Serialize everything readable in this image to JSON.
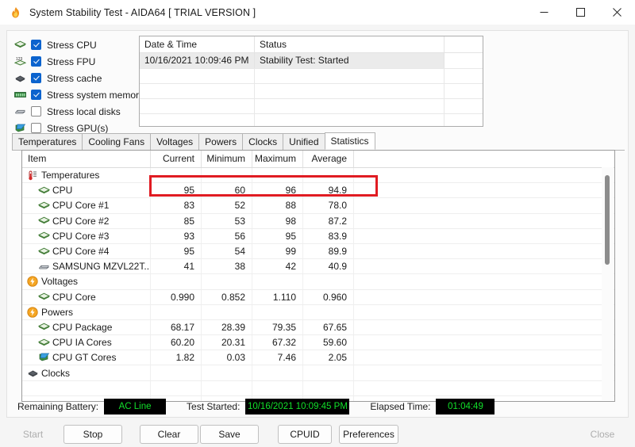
{
  "window": {
    "title": "System Stability Test - AIDA64  [ TRIAL VERSION ]",
    "app_icon": "flame-icon",
    "minimize_label": "minimize-icon",
    "maximize_label": "maximize-icon",
    "close_label": "close-icon"
  },
  "stress": {
    "items": [
      {
        "label": "Stress CPU",
        "checked": true,
        "icon": "cpu-chip-icon"
      },
      {
        "label": "Stress FPU",
        "checked": true,
        "icon": "fpu-chip-icon"
      },
      {
        "label": "Stress cache",
        "checked": true,
        "icon": "cache-icon"
      },
      {
        "label": "Stress system memory",
        "checked": true,
        "icon": "memory-module-icon"
      },
      {
        "label": "Stress local disks",
        "checked": false,
        "icon": "hard-disk-icon"
      },
      {
        "label": "Stress GPU(s)",
        "checked": false,
        "icon": "gpu-card-icon"
      }
    ]
  },
  "log": {
    "headers": [
      "Date & Time",
      "Status",
      ""
    ],
    "rows": [
      {
        "datetime": "10/16/2021 10:09:46 PM",
        "status": "Stability Test: Started",
        "extra": ""
      }
    ],
    "empty_rows": 5
  },
  "tabs": {
    "items": [
      {
        "label": "Temperatures",
        "active": false
      },
      {
        "label": "Cooling Fans",
        "active": false
      },
      {
        "label": "Voltages",
        "active": false
      },
      {
        "label": "Powers",
        "active": false
      },
      {
        "label": "Clocks",
        "active": false
      },
      {
        "label": "Unified",
        "active": false
      },
      {
        "label": "Statistics",
        "active": true
      }
    ]
  },
  "statistics": {
    "headers": [
      "Item",
      "Current",
      "Minimum",
      "Maximum",
      "Average"
    ],
    "rows": [
      {
        "item": "Temperatures",
        "icon": "thermometer-icon",
        "group": true,
        "current": "",
        "minimum": "",
        "maximum": "",
        "average": ""
      },
      {
        "item": "CPU",
        "icon": "cpu-chip-icon",
        "group": false,
        "current": "95",
        "minimum": "60",
        "maximum": "96",
        "average": "94.9",
        "highlighted": true
      },
      {
        "item": "CPU Core #1",
        "icon": "cpu-chip-icon",
        "group": false,
        "current": "83",
        "minimum": "52",
        "maximum": "88",
        "average": "78.0"
      },
      {
        "item": "CPU Core #2",
        "icon": "cpu-chip-icon",
        "group": false,
        "current": "85",
        "minimum": "53",
        "maximum": "98",
        "average": "87.2"
      },
      {
        "item": "CPU Core #3",
        "icon": "cpu-chip-icon",
        "group": false,
        "current": "93",
        "minimum": "56",
        "maximum": "95",
        "average": "83.9"
      },
      {
        "item": "CPU Core #4",
        "icon": "cpu-chip-icon",
        "group": false,
        "current": "95",
        "minimum": "54",
        "maximum": "99",
        "average": "89.9"
      },
      {
        "item": "SAMSUNG MZVL22T...",
        "icon": "hard-disk-icon",
        "group": false,
        "current": "41",
        "minimum": "38",
        "maximum": "42",
        "average": "40.9"
      },
      {
        "item": "Voltages",
        "icon": "bolt-icon",
        "group": true,
        "current": "",
        "minimum": "",
        "maximum": "",
        "average": ""
      },
      {
        "item": "CPU Core",
        "icon": "cpu-chip-icon",
        "group": false,
        "current": "0.990",
        "minimum": "0.852",
        "maximum": "1.110",
        "average": "0.960"
      },
      {
        "item": "Powers",
        "icon": "bolt-icon",
        "group": true,
        "current": "",
        "minimum": "",
        "maximum": "",
        "average": ""
      },
      {
        "item": "CPU Package",
        "icon": "cpu-chip-icon",
        "group": false,
        "current": "68.17",
        "minimum": "28.39",
        "maximum": "79.35",
        "average": "67.65"
      },
      {
        "item": "CPU IA Cores",
        "icon": "cpu-chip-icon",
        "group": false,
        "current": "60.20",
        "minimum": "20.31",
        "maximum": "67.32",
        "average": "59.60"
      },
      {
        "item": "CPU GT Cores",
        "icon": "gpu-card-icon",
        "group": false,
        "current": "1.82",
        "minimum": "0.03",
        "maximum": "7.46",
        "average": "2.05"
      },
      {
        "item": "Clocks",
        "icon": "cache-icon",
        "group": true,
        "current": "",
        "minimum": "",
        "maximum": "",
        "average": ""
      }
    ],
    "highlight_color": "#e01b22",
    "empty_rows": 4
  },
  "status": {
    "battery_label": "Remaining Battery:",
    "battery_value": "AC Line",
    "started_label": "Test Started:",
    "started_value": "10/16/2021 10:09:45 PM",
    "elapsed_label": "Elapsed Time:",
    "elapsed_value": "01:04:49",
    "value_color": "#12e02b"
  },
  "buttons": {
    "start": "Start",
    "stop": "Stop",
    "clear": "Clear",
    "save": "Save",
    "cpuid": "CPUID",
    "preferences": "Preferences",
    "close": "Close"
  }
}
